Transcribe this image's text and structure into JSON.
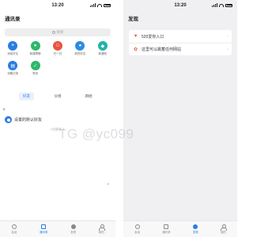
{
  "left": {
    "time": "13:20",
    "title": "通讯录",
    "search_placeholder": "搜索",
    "shortcuts": [
      {
        "label": "添加好友",
        "icon": "add-friend-icon",
        "color": "#2a7de1",
        "glyph": "+"
      },
      {
        "label": "新建群聊",
        "icon": "group-chat-icon",
        "color": "#2fb76b",
        "glyph": "●"
      },
      {
        "label": "扫一扫",
        "icon": "scan-icon",
        "color": "#e8543f",
        "glyph": "□"
      },
      {
        "label": "新的好友",
        "icon": "new-friend-icon",
        "color": "#2a8de1",
        "glyph": "●"
      },
      {
        "label": "新通知",
        "icon": "notification-icon",
        "color": "#22b3a8",
        "glyph": "◆"
      },
      {
        "label": "设备记录",
        "icon": "device-record-icon",
        "color": "#2a7de1",
        "glyph": "▤"
      },
      {
        "label": "签到",
        "icon": "check-in-icon",
        "color": "#2fb76b",
        "glyph": "✓"
      }
    ],
    "tabs": [
      "好友",
      "分组",
      "群组"
    ],
    "active_tab": "好友",
    "index_header": "#",
    "friend_name": "设置的默认好友",
    "friend_count": "1位联系人",
    "index_mark": "#"
  },
  "right": {
    "time": "13:20",
    "title": "发现",
    "items": [
      {
        "label": "520爱你入口",
        "icon": "heart-badge-icon"
      },
      {
        "label": "这里可以跳蓄任何网站",
        "icon": "link-icon"
      }
    ]
  },
  "tabbar": [
    "会话",
    "通讯录",
    "发现",
    "我的"
  ],
  "left_active_tab": "通讯录",
  "right_active_tab": "发现",
  "watermark": "TG @yc099",
  "colors": {
    "accent": "#2a7de1",
    "bg_gray": "#f0f0f2"
  }
}
